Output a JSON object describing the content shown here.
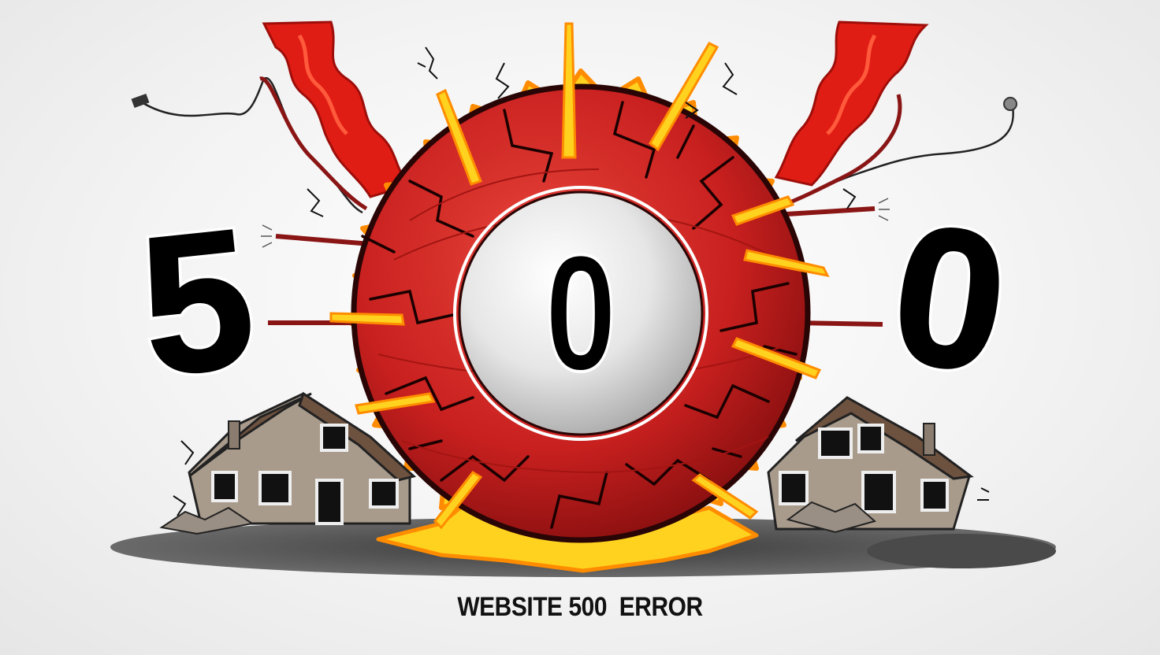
{
  "digits": {
    "left": "5",
    "center": "0",
    "right": "0"
  },
  "caption": "WEBSITE 500  ERROR",
  "colors": {
    "background": "#f3f3f3",
    "ball_red": "#c8201f",
    "ball_dark_red": "#8a0f10",
    "flame_yellow": "#ffd21f",
    "flame_orange": "#ff8c00",
    "smoke_red": "#e01d14",
    "digit_fill": "#000000",
    "digit_outline": "#ffffff",
    "house_wall": "#a89b8c",
    "house_roof": "#6e5240",
    "ground": "#555555"
  },
  "icons": [
    "house-icon",
    "wire-icon",
    "explosion-icon",
    "cracked-ball-icon"
  ]
}
